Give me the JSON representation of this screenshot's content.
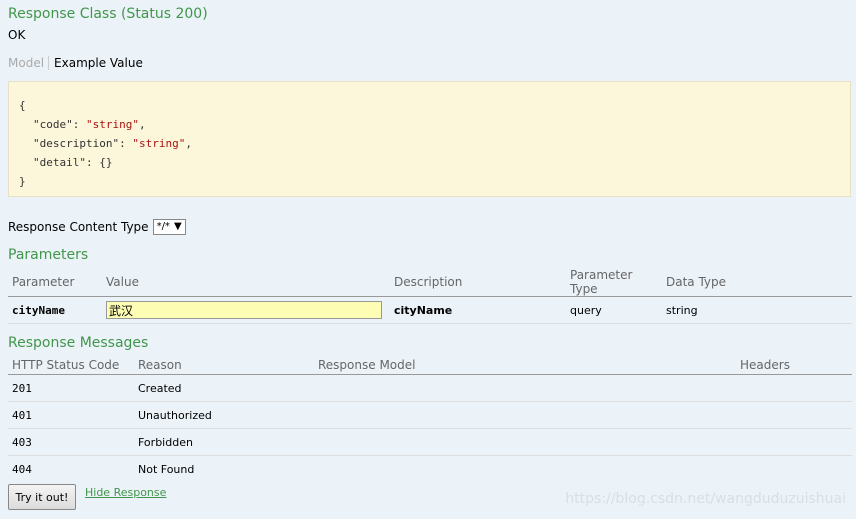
{
  "response_class": {
    "title": "Response Class (Status 200)",
    "status": "OK",
    "tabs": {
      "model": "Model",
      "example": "Example Value"
    },
    "example_json": {
      "open": "{",
      "close": "}",
      "lines": [
        {
          "key": "\"code\"",
          "value": "\"string\"",
          "suffix": ","
        },
        {
          "key": "\"description\"",
          "value": "\"string\"",
          "suffix": ","
        },
        {
          "key": "\"detail\"",
          "value": "{}",
          "suffix": ""
        }
      ]
    }
  },
  "content_type": {
    "label": "Response Content Type",
    "selected": "*/*",
    "arrow": "▼"
  },
  "parameters": {
    "title": "Parameters",
    "headers": [
      "Parameter",
      "Value",
      "Description",
      "Parameter Type",
      "Data Type"
    ],
    "rows": [
      {
        "name": "cityName",
        "value": "武汉",
        "description": "cityName",
        "param_type": "query",
        "data_type": "string"
      }
    ]
  },
  "response_messages": {
    "title": "Response Messages",
    "headers": [
      "HTTP Status Code",
      "Reason",
      "Response Model",
      "Headers"
    ],
    "rows": [
      {
        "code": "201",
        "reason": "Created"
      },
      {
        "code": "401",
        "reason": "Unauthorized"
      },
      {
        "code": "403",
        "reason": "Forbidden"
      },
      {
        "code": "404",
        "reason": "Not Found"
      }
    ]
  },
  "actions": {
    "try_label": "Try it out!",
    "hide_label": "Hide Response"
  },
  "watermark": "https://blog.csdn.net/wangduduzuishuai",
  "colors": {
    "accent": "#41964b",
    "example_bg": "#fcf6db",
    "input_bg": "#fdfdb4",
    "page_bg": "#ebf3f9"
  }
}
